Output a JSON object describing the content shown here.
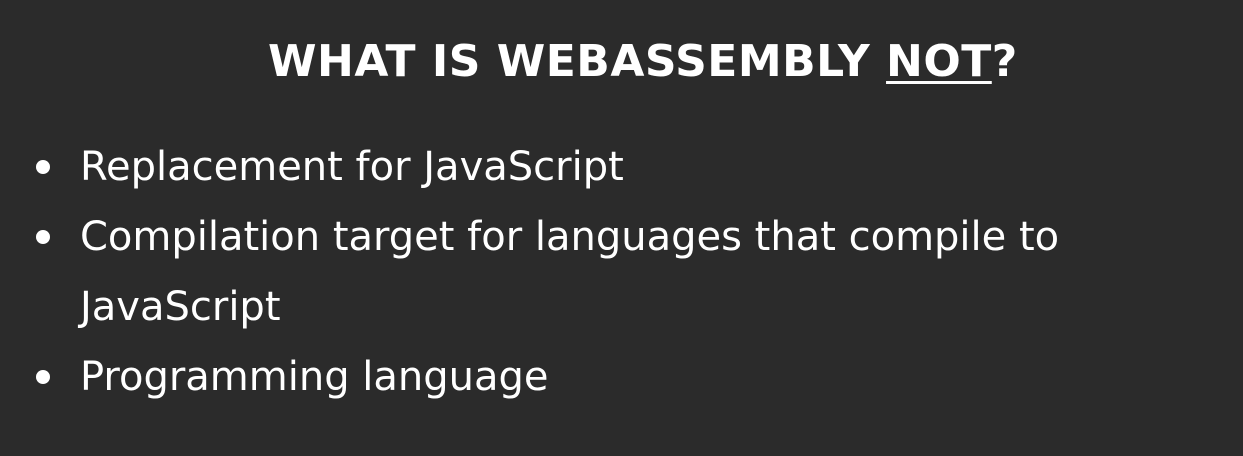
{
  "slide": {
    "title": {
      "prefix": "WHAT IS WEBASSEMBLY ",
      "emphasis": "NOT",
      "suffix": "?"
    },
    "bullets": [
      {
        "text": "Replacement for JavaScript"
      },
      {
        "text": "Compilation target for languages that compile to JavaScript"
      },
      {
        "text": "Programming language"
      }
    ]
  },
  "colors": {
    "background": "#2b2b2b",
    "text": "#ffffff"
  }
}
